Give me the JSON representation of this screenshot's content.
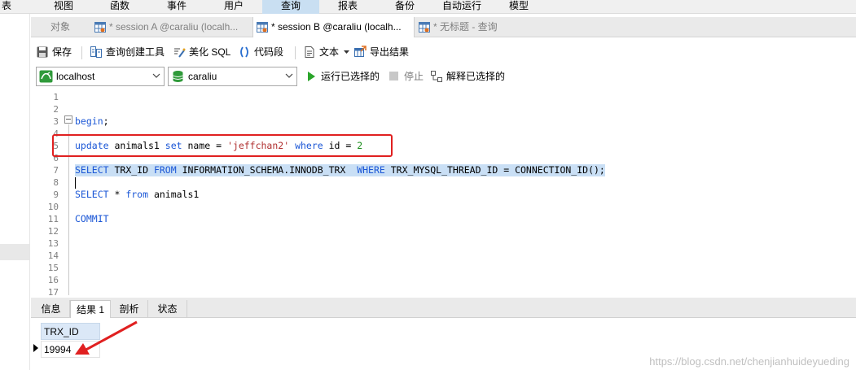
{
  "menu": {
    "items": [
      "表",
      "视图",
      "函数",
      "事件",
      "用户",
      "查询",
      "报表",
      "备份",
      "自动运行",
      "模型"
    ],
    "active_index": 5
  },
  "tabs": [
    {
      "label": "对象",
      "active": false,
      "icon": ""
    },
    {
      "label": "* session A @caraliu (localh...",
      "active": false,
      "icon": "query-table-icon"
    },
    {
      "label": "* session B @caraliu (localh...",
      "active": true,
      "icon": "query-table-icon"
    },
    {
      "label": "* 无标题 - 查询",
      "active": false,
      "icon": "query-table-icon"
    }
  ],
  "toolbar": {
    "save_label": "保存",
    "query_builder_label": "查询创建工具",
    "beautify_label": "美化 SQL",
    "snippet_label": "代码段",
    "text_label": "文本",
    "export_label": "导出结果"
  },
  "connection": {
    "host": "localhost",
    "database": "caraliu",
    "run_selected_label": "运行已选择的",
    "stop_label": "停止",
    "explain_label": "解释已选择的"
  },
  "editor": {
    "line_numbers": [
      "1",
      "2",
      "3",
      "4",
      "5",
      "6",
      "7",
      "8",
      "9",
      "10",
      "11",
      "12",
      "13",
      "14",
      "15",
      "16",
      "17"
    ],
    "lines": {
      "l3": {
        "kw": "begin",
        "rest": ";"
      },
      "l5": {
        "kw1": "update",
        "t1": " animals1 ",
        "kw2": "set",
        "t2": " name = ",
        "str": "'jeffchan2'",
        "t3": " ",
        "kw3": "where",
        "t4": " id = ",
        "num": "2"
      },
      "l7": {
        "kw1": "SELECT",
        "t1": " TRX_ID ",
        "kw2": "FROM",
        "t2": " INFORMATION_SCHEMA.INNODB_TRX  ",
        "kw3": "WHERE",
        "t3": " TRX_MYSQL_THREAD_ID = CONNECTION_ID();"
      },
      "l9": {
        "kw1": "SELECT",
        "t1": " * ",
        "kw2": "from",
        "t2": " animals1"
      },
      "l11": {
        "kw": "COMMIT"
      }
    }
  },
  "result_tabs": [
    "信息",
    "结果 1",
    "剖析",
    "状态"
  ],
  "result_active_index": 1,
  "result": {
    "column": "TRX_ID",
    "rows": [
      "19994"
    ]
  },
  "watermark": "https://blog.csdn.net/chenjianhuideyueding",
  "colors": {
    "keyword": "#1a56d6",
    "string": "#b03030",
    "number": "#1a8c1a",
    "annotation_red": "#e02020",
    "selection": "#c9dff5"
  }
}
